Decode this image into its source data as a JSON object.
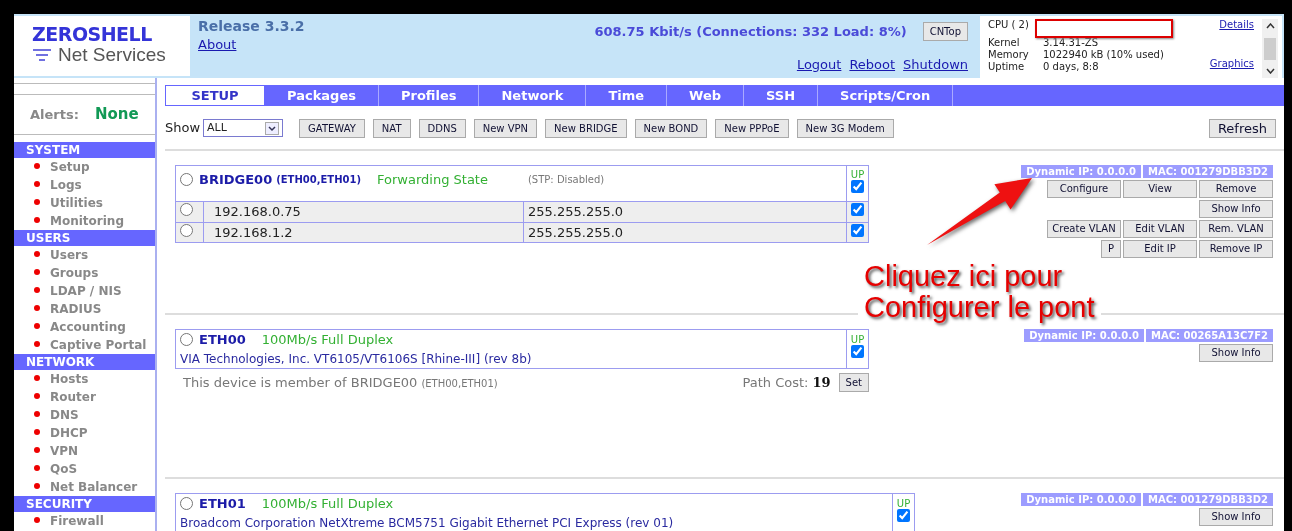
{
  "header": {
    "logo_title": "ZEROSHELL",
    "logo_subtitle": "Net Services",
    "release": "Release 3.3.2",
    "about_link": "About",
    "traffic": "608.75 Kbit/s (Connections: 332 Load: 8%)",
    "cntop_button": "CNTop",
    "links": [
      "Logout",
      "Reboot",
      "Shutdown"
    ],
    "sysinfo": {
      "rows": [
        {
          "label": "CPU ( 2)",
          "value": "",
          "redacted": true
        },
        {
          "label": "Kernel",
          "value": "3.14.31-ZS"
        },
        {
          "label": "Memory",
          "value": "1022940 kB  (10% used)"
        },
        {
          "label": "Uptime",
          "value": "0 days, 8:8"
        }
      ],
      "links": [
        "Details",
        "Graphics"
      ]
    }
  },
  "sidebar": {
    "alerts_label": "Alerts:",
    "alerts_value": "None",
    "sections": [
      {
        "title": "SYSTEM",
        "items": [
          "Setup",
          "Logs",
          "Utilities",
          "Monitoring"
        ]
      },
      {
        "title": "USERS",
        "items": [
          "Users",
          "Groups",
          "LDAP / NIS",
          "RADIUS",
          "Accounting",
          "Captive Portal"
        ]
      },
      {
        "title": "NETWORK",
        "items": [
          "Hosts",
          "Router",
          "DNS",
          "DHCP",
          "VPN",
          "QoS",
          "Net Balancer"
        ]
      },
      {
        "title": "SECURITY",
        "items": [
          "Firewall"
        ]
      }
    ]
  },
  "tabs": [
    {
      "label": "SETUP",
      "selected": true
    },
    {
      "label": "Packages",
      "selected": false
    },
    {
      "label": "Profiles",
      "selected": false
    },
    {
      "label": "Network",
      "selected": false
    },
    {
      "label": "Time",
      "selected": false
    },
    {
      "label": "Web",
      "selected": false
    },
    {
      "label": "SSH",
      "selected": false
    },
    {
      "label": "Scripts/Cron",
      "selected": false
    }
  ],
  "toolbar": {
    "show_label": "Show",
    "show_value": "ALL",
    "buttons": [
      "GATEWAY",
      "NAT",
      "DDNS",
      "New VPN",
      "New BRIDGE",
      "New BOND",
      "New PPPoE",
      "New 3G Modem"
    ],
    "refresh": "Refresh"
  },
  "devices": [
    {
      "kind": "bridge",
      "name": "BRIDGE00",
      "members": "(ETH00,ETH01)",
      "state": "Forwarding State",
      "stp": "(STP: Disabled)",
      "up_label": "UP",
      "up": true,
      "selected": false,
      "addresses": [
        {
          "ip": "192.168.0.75",
          "netmask": "255.255.255.0",
          "enabled": true,
          "selected": false
        },
        {
          "ip": "192.168.1.2",
          "netmask": "255.255.255.0",
          "enabled": true,
          "selected": false
        }
      ],
      "ip_badge": "Dynamic IP: 0.0.0.0",
      "mac_badge": "MAC: 001279DBB3D2",
      "action_rows": [
        [
          "Configure",
          "View",
          "Remove"
        ],
        [
          "Show Info"
        ],
        [
          "Create VLAN",
          "Edit VLAN",
          "Rem. VLAN"
        ],
        [
          "P",
          "Edit IP",
          "Remove IP"
        ]
      ]
    },
    {
      "kind": "ethernet",
      "name": "ETH00",
      "speed": "100Mb/s Full Duplex",
      "description": "VIA Technologies, Inc. VT6105/VT6106S [Rhine-III] (rev 8b)",
      "up_label": "UP",
      "up": true,
      "selected": false,
      "member_note": "This device is member of BRIDGE00",
      "member_note_members": "(ETH00,ETH01)",
      "path_cost_label": "Path Cost:",
      "path_cost": "19",
      "set_button": "Set",
      "ip_badge": "Dynamic IP: 0.0.0.0",
      "mac_badge": "MAC: 00265A13C7F2",
      "action_rows": [
        [
          "Show Info"
        ]
      ]
    },
    {
      "kind": "ethernet",
      "name": "ETH01",
      "speed": "100Mb/s Full Duplex",
      "description": "Broadcom Corporation NetXtreme BCM5751 Gigabit Ethernet PCI Express (rev 01)",
      "up_label": "UP",
      "up": true,
      "selected": false,
      "ip_badge": "Dynamic IP: 0.0.0.0",
      "mac_badge": "MAC: 001279DBB3D2",
      "action_rows": [
        [
          "Show Info"
        ]
      ]
    }
  ],
  "annotation": {
    "lines": [
      "Cliquez ici pour",
      "Configurer le pont"
    ]
  }
}
